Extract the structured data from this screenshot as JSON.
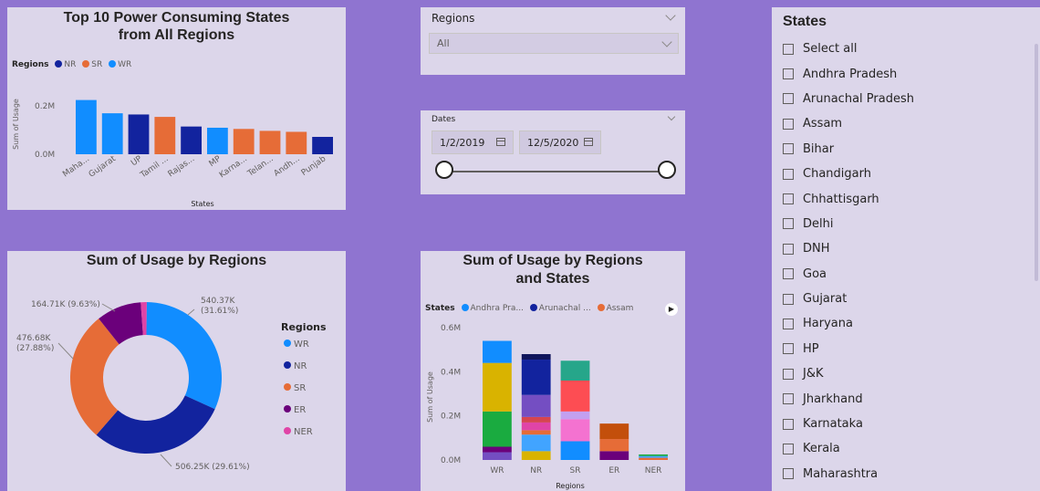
{
  "colors": {
    "WR": "#118dff",
    "NR": "#12239e",
    "SR": "#e66c37",
    "ER": "#6b007b",
    "NER": "#e044a7"
  },
  "bar_card": {
    "title_line1": "Top 10 Power Consuming States",
    "title_line2": "from All Regions",
    "legend_title": "Regions",
    "legend_items": [
      "NR",
      "SR",
      "WR"
    ]
  },
  "regions_slicer": {
    "label": "Regions",
    "value": "All"
  },
  "dates_slicer": {
    "label": "Dates",
    "start": "1/2/2019",
    "end": "12/5/2020"
  },
  "states_slicer": {
    "title": "States",
    "items": [
      "Select all",
      "Andhra Pradesh",
      "Arunachal Pradesh",
      "Assam",
      "Bihar",
      "Chandigarh",
      "Chhattisgarh",
      "Delhi",
      "DNH",
      "Goa",
      "Gujarat",
      "Haryana",
      "HP",
      "J&K",
      "Jharkhand",
      "Karnataka",
      "Kerala",
      "Maharashtra"
    ]
  },
  "donut_card": {
    "title": "Sum of Usage by Regions",
    "legend_title": "Regions"
  },
  "stack_card": {
    "title_line1": "Sum of Usage by Regions",
    "title_line2": "and States",
    "legend_title": "States",
    "legend_items": [
      {
        "name": "Andhra Pra...",
        "color": "#118dff"
      },
      {
        "name": "Arunachal ...",
        "color": "#12239e"
      },
      {
        "name": "Assam",
        "color": "#e66c37"
      }
    ]
  },
  "chart_data": [
    {
      "type": "bar",
      "title": "Top 10 Power Consuming States from All Regions",
      "xlabel": "States",
      "ylabel": "Sum of Usage",
      "categories": [
        "Maha...",
        "Gujarat",
        "UP",
        "Tamil ...",
        "Rajas...",
        "MP",
        "Karna...",
        "Telan...",
        "Andh...",
        "Punjab"
      ],
      "regions": [
        "WR",
        "WR",
        "NR",
        "SR",
        "NR",
        "WR",
        "SR",
        "SR",
        "SR",
        "NR"
      ],
      "values": [
        0.225,
        0.17,
        0.165,
        0.155,
        0.115,
        0.11,
        0.105,
        0.097,
        0.093,
        0.072
      ],
      "unit": "M",
      "yticks": [
        "0.0M",
        "0.2M"
      ],
      "ylim": [
        0,
        0.25
      ],
      "legend": [
        "NR",
        "SR",
        "WR"
      ]
    },
    {
      "type": "pie",
      "title": "Sum of Usage by Regions",
      "labels": [
        "WR",
        "NR",
        "SR",
        "ER",
        "NER"
      ],
      "values": [
        540.37,
        506.25,
        476.68,
        164.71,
        21.52
      ],
      "value_labels": [
        "540.37K\n(31.61%)",
        "506.25K (29.61%)",
        "476.68K\n(27.88%)",
        "164.71K (9.63%)",
        ""
      ]
    },
    {
      "type": "bar",
      "stacked": true,
      "title": "Sum of Usage by Regions and States",
      "xlabel": "Regions",
      "ylabel": "Sum of Usage",
      "categories": [
        "WR",
        "NR",
        "SR",
        "ER",
        "NER"
      ],
      "yticks": [
        "0.0M",
        "0.2M",
        "0.4M",
        "0.6M"
      ],
      "ylim": [
        0,
        0.6
      ],
      "segments": [
        [
          {
            "v": 0.035,
            "c": "#744ec2"
          },
          {
            "v": 0.025,
            "c": "#6b007b"
          },
          {
            "v": 0.16,
            "c": "#1aab40"
          },
          {
            "v": 0.22,
            "c": "#d9b300"
          },
          {
            "v": 0.1,
            "c": "#118dff"
          }
        ],
        [
          {
            "v": 0.04,
            "c": "#d9b300"
          },
          {
            "v": 0.075,
            "c": "#41a4ff"
          },
          {
            "v": 0.02,
            "c": "#e66c37"
          },
          {
            "v": 0.035,
            "c": "#e044a7"
          },
          {
            "v": 0.025,
            "c": "#d64550"
          },
          {
            "v": 0.1,
            "c": "#744ec2"
          },
          {
            "v": 0.16,
            "c": "#12239e"
          },
          {
            "v": 0.025,
            "c": "#10165c"
          }
        ],
        [
          {
            "v": 0.085,
            "c": "#118dff"
          },
          {
            "v": 0.1,
            "c": "#f472d0"
          },
          {
            "v": 0.035,
            "c": "#c3a0f0"
          },
          {
            "v": 0.14,
            "c": "#fd4d53"
          },
          {
            "v": 0.09,
            "c": "#26a68a"
          }
        ],
        [
          {
            "v": 0.04,
            "c": "#6b007b"
          },
          {
            "v": 0.055,
            "c": "#e66c37"
          },
          {
            "v": 0.07,
            "c": "#c34f0b"
          }
        ],
        [
          {
            "v": 0.01,
            "c": "#e66c37"
          },
          {
            "v": 0.008,
            "c": "#41a4ff"
          },
          {
            "v": 0.007,
            "c": "#1aab40"
          }
        ]
      ]
    }
  ]
}
